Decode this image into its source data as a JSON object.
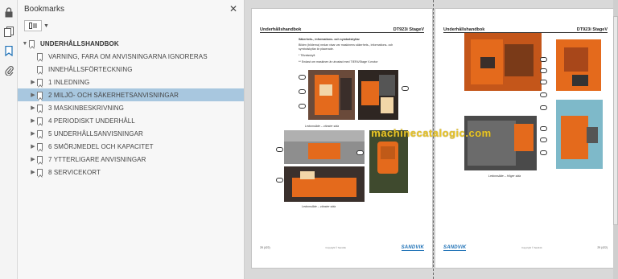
{
  "panel": {
    "title": "Bookmarks",
    "close_label": "✕"
  },
  "bookmarks": {
    "root": "UNDERHÅLLSHANDBOK",
    "items": [
      {
        "label": "VARNING, FARA OM ANVISNINGARNA IGNORERAS",
        "expandable": false,
        "selected": false
      },
      {
        "label": "INNEHÅLLSFÖRTECKNING",
        "expandable": false,
        "selected": false
      },
      {
        "label": "1 INLEDNING",
        "expandable": true,
        "selected": false
      },
      {
        "label": "2 MILJÖ- OCH SÄKERHETSANVISNINGAR",
        "expandable": true,
        "selected": true
      },
      {
        "label": "3 MASKINBESKRIVNING",
        "expandable": true,
        "selected": false
      },
      {
        "label": "4 PERIODISKT UNDERHÅLL",
        "expandable": true,
        "selected": false
      },
      {
        "label": "5 UNDERHÅLLSANVISNINGAR",
        "expandable": true,
        "selected": false
      },
      {
        "label": "6 SMÖRJMEDEL OCH KAPACITET",
        "expandable": true,
        "selected": false
      },
      {
        "label": "7 YTTERLIGARE ANVISNINGAR",
        "expandable": true,
        "selected": false
      },
      {
        "label": "8 SERVICEKORT",
        "expandable": true,
        "selected": false
      }
    ]
  },
  "viewer": {
    "watermark": "machinecatalogic.com",
    "left_page": {
      "header_left": "Underhållshandbok",
      "header_right": "DT923i StageV",
      "section_title": "Säkerhets-, informations- och symbolskyltar",
      "body_line_1": "Bilden (bilderna) nedan visar var maskinens säkerhets-, informations- och",
      "body_line_2": "symbolskyltar är placerade.",
      "note_1": "* Tillvalsskylt",
      "note_2": "** Endast om maskinen är utrustad med TIER4/Stage V-motor",
      "caption_1": "Ledomsåde – vänster sida",
      "caption_2": "Ledomsåde – vänster sida",
      "page_num": "28 (422)",
      "copyright": "Copyright © Sandvik",
      "brand": "SANDVIK"
    },
    "right_page": {
      "header_left": "Underhållshandbok",
      "header_right": "DT923i StageV",
      "caption_1": "Ledomsåde – Höger sida",
      "page_num": "29 (422)",
      "copyright": "Copyright © Sandvik",
      "brand": "SANDVIK"
    }
  },
  "icons": {
    "lock": "lock-icon",
    "pages": "pages-icon",
    "bookmark": "bookmark-icon",
    "attachment": "paperclip-icon"
  },
  "colors": {
    "selected_row": "#a8c7df",
    "accent_blue": "#1b6fb5",
    "watermark": "#e8c52a",
    "machine_orange": "#e46a1c"
  }
}
